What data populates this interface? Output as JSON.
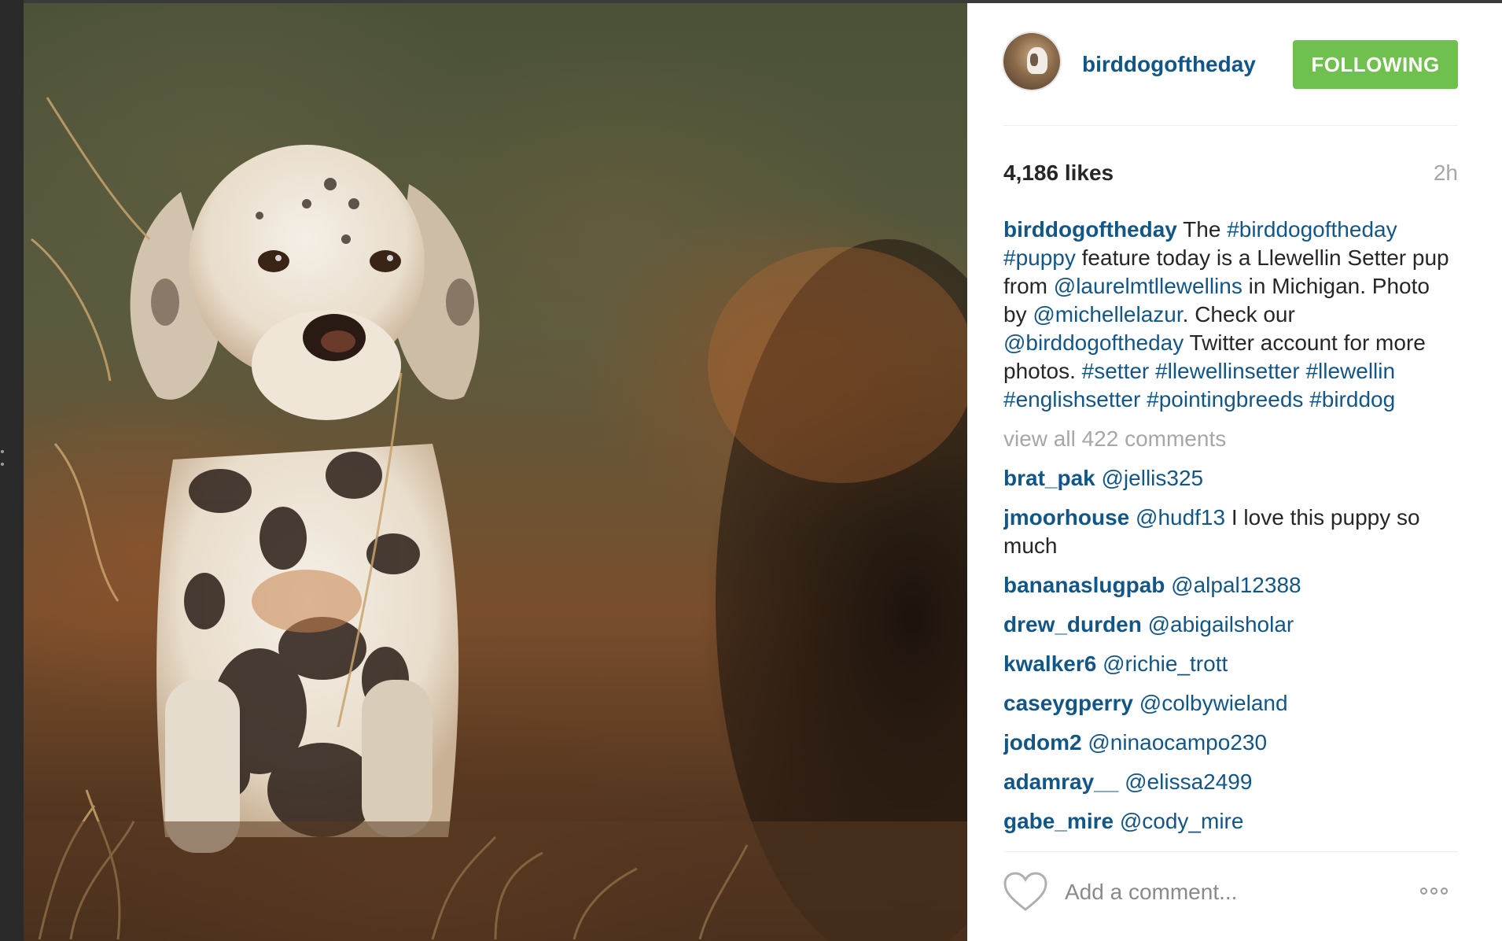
{
  "post": {
    "author": "birddogoftheday",
    "follow_label": "FOLLOWING",
    "likes": "4,186 likes",
    "time": "2h",
    "caption": {
      "user": "birddogoftheday",
      "parts": [
        {
          "t": " The ",
          "tag": false
        },
        {
          "t": "#birddogoftheday",
          "tag": true
        },
        {
          "t": " ",
          "tag": false
        },
        {
          "t": "#puppy",
          "tag": true
        },
        {
          "t": " feature today is a Llewellin Setter pup from ",
          "tag": false
        },
        {
          "t": "@laurelmtllewellins",
          "tag": true
        },
        {
          "t": " in Michigan. Photo by ",
          "tag": false
        },
        {
          "t": "@michellelazur",
          "tag": true
        },
        {
          "t": ". Check our ",
          "tag": false
        },
        {
          "t": "@birddogoftheday",
          "tag": true
        },
        {
          "t": " Twitter account for more photos. ",
          "tag": false
        },
        {
          "t": "#setter",
          "tag": true
        },
        {
          "t": " ",
          "tag": false
        },
        {
          "t": "#llewellinsetter",
          "tag": true
        },
        {
          "t": " ",
          "tag": false
        },
        {
          "t": "#llewellin",
          "tag": true
        },
        {
          "t": " ",
          "tag": false
        },
        {
          "t": "#englishsetter",
          "tag": true
        },
        {
          "t": " ",
          "tag": false
        },
        {
          "t": "#pointingbreeds",
          "tag": true
        },
        {
          "t": " ",
          "tag": false
        },
        {
          "t": "#birddog",
          "tag": true
        }
      ]
    },
    "view_all": "view all 422 comments",
    "comments": [
      {
        "user": "brat_pak",
        "mention": "@jellis325",
        "text": ""
      },
      {
        "user": "jmoorhouse",
        "mention": "@hudf13",
        "text": " I love this puppy so much"
      },
      {
        "user": "bananaslugpab",
        "mention": "@alpal12388",
        "text": ""
      },
      {
        "user": "drew_durden",
        "mention": "@abigailsholar",
        "text": ""
      },
      {
        "user": "kwalker6",
        "mention": "@richie_trott",
        "text": ""
      },
      {
        "user": "caseygperry",
        "mention": "@colbywieland",
        "text": ""
      },
      {
        "user": "jodom2",
        "mention": "@ninaocampo230",
        "text": ""
      },
      {
        "user": "adamray__",
        "mention": "@elissa2499",
        "text": ""
      },
      {
        "user": "gabe_mire",
        "mention": "@cody_mire",
        "text": ""
      }
    ],
    "add_comment_placeholder": "Add a comment...",
    "icons": {
      "like": "heart-outline-icon",
      "more": "more-options-icon"
    },
    "colors": {
      "link": "#125688",
      "follow_bg": "#70c050",
      "muted": "#a5a7aa"
    }
  }
}
